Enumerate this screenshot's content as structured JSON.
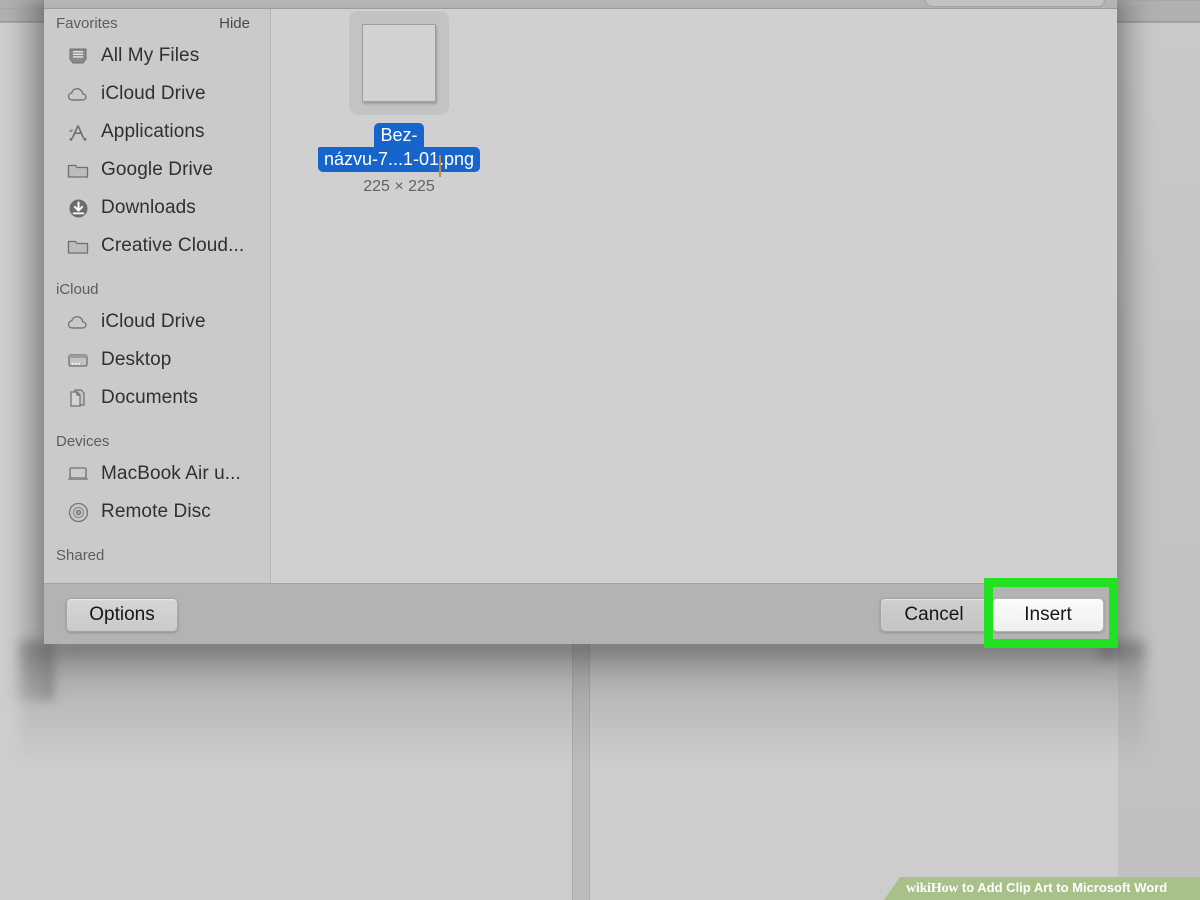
{
  "background": {
    "description": "dimmed-word-document"
  },
  "dialog": {
    "search": {
      "placeholder": "",
      "value": ""
    },
    "sidebar": {
      "sections": [
        {
          "title": "Favorites",
          "action_label": "Hide",
          "items": [
            {
              "label": "All My Files",
              "icon": "all-my-files-icon"
            },
            {
              "label": "iCloud Drive",
              "icon": "cloud-icon"
            },
            {
              "label": "Applications",
              "icon": "applications-icon"
            },
            {
              "label": "Google Drive",
              "icon": "folder-icon"
            },
            {
              "label": "Downloads",
              "icon": "downloads-icon"
            },
            {
              "label": "Creative Cloud...",
              "icon": "folder-icon"
            }
          ]
        },
        {
          "title": "iCloud",
          "action_label": "",
          "items": [
            {
              "label": "iCloud Drive",
              "icon": "cloud-icon"
            },
            {
              "label": "Desktop",
              "icon": "desktop-icon"
            },
            {
              "label": "Documents",
              "icon": "documents-icon"
            }
          ]
        },
        {
          "title": "Devices",
          "action_label": "",
          "items": [
            {
              "label": "MacBook Air u...",
              "icon": "laptop-icon"
            },
            {
              "label": "Remote Disc",
              "icon": "disc-icon"
            }
          ]
        },
        {
          "title": "Shared",
          "action_label": "",
          "items": []
        }
      ]
    },
    "files": [
      {
        "name_line_1": "Bez-",
        "name_line_2": "názvu-7...1-01.png",
        "dimensions": "225 × 225",
        "selected": true
      }
    ],
    "buttons": {
      "options": "Options",
      "cancel": "Cancel",
      "insert": "Insert"
    }
  },
  "highlight": {
    "color": "#22e022",
    "target": "insert-button"
  },
  "watermark": {
    "brand": "wikiHow",
    "text": " to Add Clip Art to Microsoft Word",
    "background_color": "#a8c08a"
  },
  "colors": {
    "selection_blue": "#1765cc",
    "dialog_gray": "#cfcfcf",
    "sidebar_gray": "#cacaca",
    "bottombar_gray": "#b3b3b3"
  }
}
